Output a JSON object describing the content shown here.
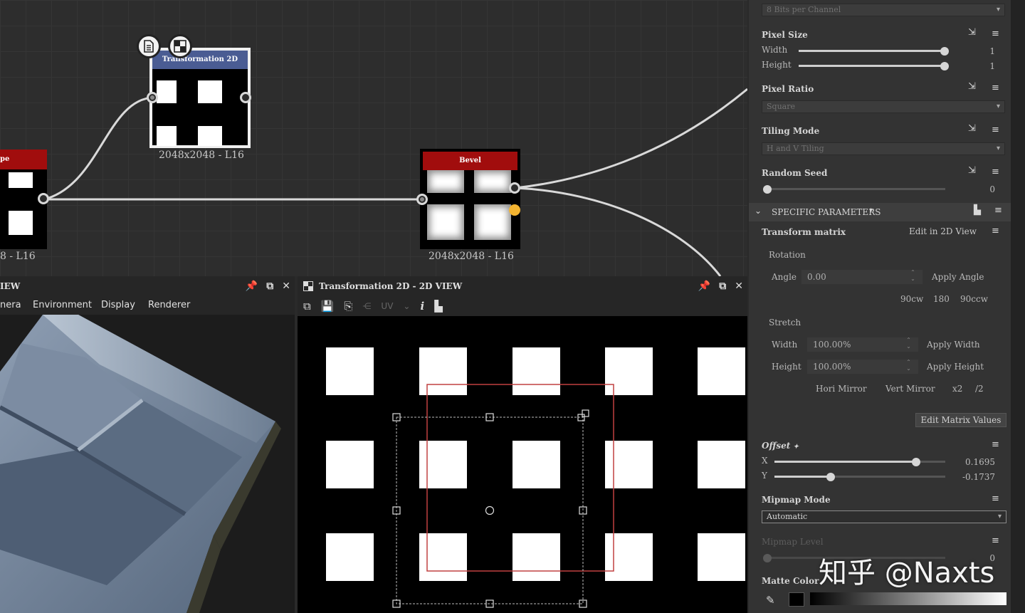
{
  "graph": {
    "nodes": [
      {
        "id": "transformation",
        "title": "Transformation 2D",
        "resolution": "2048x2048 - L16",
        "title_color": "#4a5c93"
      },
      {
        "id": "bevel",
        "title": "Bevel",
        "resolution": "2048x2048 - L16",
        "title_color": "#a10d0d"
      },
      {
        "id": "shape",
        "title": "pe",
        "resolution": "8 - L16",
        "title_color": "#a10d0d"
      }
    ]
  },
  "view3d": {
    "title": "IEW",
    "menu": [
      "nera",
      "Environment",
      "Display",
      "Renderer"
    ]
  },
  "view2d": {
    "title": "Transformation 2D - 2D VIEW",
    "toolbar_dim_label": "UV"
  },
  "props": {
    "top_dropdown": "8 Bits per Channel",
    "pixel_size": {
      "label": "Pixel Size",
      "width_label": "Width",
      "width_value": "1",
      "width_level": 1.0,
      "height_label": "Height",
      "height_value": "1",
      "height_level": 1.0
    },
    "pixel_ratio": {
      "label": "Pixel Ratio",
      "value": "Square"
    },
    "tiling_mode": {
      "label": "Tiling Mode",
      "value": "H and V Tiling"
    },
    "random_seed": {
      "label": "Random Seed",
      "value": "0",
      "level": 0.0
    },
    "specific_section": {
      "label": "SPECIFIC PARAMETERS",
      "marker": "✦"
    },
    "transform_matrix": {
      "label": "Transform matrix",
      "edit_link": "Edit in 2D View"
    },
    "rotation": {
      "label": "Rotation",
      "angle_label": "Angle",
      "angle_value": "0.00",
      "apply_label": "Apply Angle",
      "presets": [
        "90cw",
        "180",
        "90ccw"
      ]
    },
    "stretch": {
      "label": "Stretch",
      "width_label": "Width",
      "width_value": "100.00%",
      "apply_width": "Apply Width",
      "height_label": "Height",
      "height_value": "100.00%",
      "apply_height": "Apply Height",
      "ops": [
        "Hori Mirror",
        "Vert Mirror",
        "x2",
        "/2"
      ]
    },
    "edit_matrix_button": "Edit Matrix Values",
    "offset": {
      "label": "Offset",
      "marker": "✦",
      "x_label": "X",
      "x_value": "0.1695",
      "x_level": 0.83,
      "y_label": "Y",
      "y_value": "-0.1737",
      "y_level": 0.33
    },
    "mipmap_mode": {
      "label": "Mipmap Mode",
      "value": "Automatic"
    },
    "mipmap_level": {
      "label": "Mipmap Level",
      "value": "0"
    },
    "matte_color": {
      "label": "Matte Color"
    }
  },
  "watermark": "知乎 @Naxts",
  "colors": {
    "accent_yellow": "#f3b431",
    "node_red": "#a10d0d",
    "node_blue": "#4a5c93",
    "selection_red": "#c04040"
  }
}
